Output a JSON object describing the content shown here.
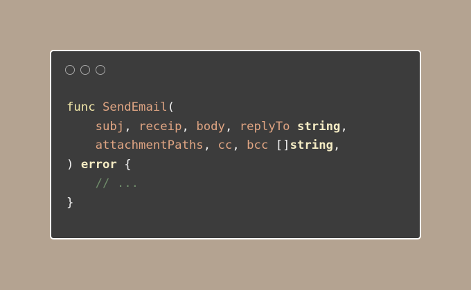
{
  "window": {
    "controls": [
      "close",
      "minimize",
      "maximize"
    ]
  },
  "code": {
    "line1": {
      "keyword": "func",
      "func_name": "SendEmail",
      "open_paren": "("
    },
    "line2": {
      "p1": "subj",
      "c1": ",",
      "p2": "receip",
      "c2": ",",
      "p3": "body",
      "c3": ",",
      "p4": "replyTo",
      "type": "string",
      "c4": ","
    },
    "line3": {
      "p1": "attachmentPaths",
      "c1": ",",
      "p2": "cc",
      "c2": ",",
      "p3": "bcc",
      "slice": "[]",
      "type": "string",
      "c3": ","
    },
    "line4": {
      "close_paren": ")",
      "ret_type": "error",
      "brace": "{"
    },
    "line5": {
      "comment": "// ..."
    },
    "line6": {
      "brace": "}"
    }
  },
  "colors": {
    "background": "#b4a391",
    "editor_bg": "#3c3c3c",
    "keyword": "#f0e6a8",
    "identifier": "#e0a583",
    "type": "#f5ecc4",
    "punctuation": "#efefef",
    "comment": "#6f8c6a"
  }
}
